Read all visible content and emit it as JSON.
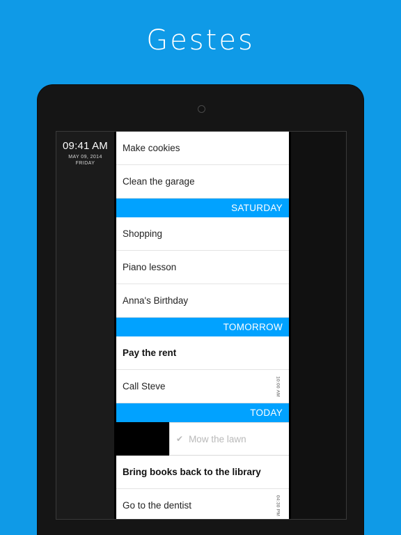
{
  "app": {
    "title": "Gestes",
    "background_color": "#0f9ae7",
    "accent_color": "#01a2ff"
  },
  "device": {
    "type": "tablet-frame",
    "camera": "camera-dot"
  },
  "clock": {
    "time": "09:41 AM",
    "date": "MAY 09, 2014",
    "weekday": "FRIDAY"
  },
  "list": {
    "rows": [
      {
        "kind": "task",
        "label": "Make cookies",
        "bold": false,
        "done": false,
        "time": ""
      },
      {
        "kind": "task",
        "label": "Clean the garage",
        "bold": false,
        "done": false,
        "time": ""
      },
      {
        "kind": "section",
        "label": "SATURDAY"
      },
      {
        "kind": "task",
        "label": "Shopping",
        "bold": false,
        "done": false,
        "time": ""
      },
      {
        "kind": "task",
        "label": "Piano lesson",
        "bold": false,
        "done": false,
        "time": ""
      },
      {
        "kind": "task",
        "label": "Anna's Birthday",
        "bold": false,
        "done": false,
        "time": ""
      },
      {
        "kind": "section",
        "label": "TOMORROW"
      },
      {
        "kind": "task",
        "label": "Pay the rent",
        "bold": true,
        "done": false,
        "time": ""
      },
      {
        "kind": "task",
        "label": "Call Steve",
        "bold": false,
        "done": false,
        "time": "10:00 AM"
      },
      {
        "kind": "section",
        "label": "TODAY"
      },
      {
        "kind": "swiped",
        "label": "Mow the lawn",
        "bold": false,
        "done": true,
        "time": "",
        "check_icon": "check-icon"
      },
      {
        "kind": "task",
        "label": "Bring books back to the library",
        "bold": true,
        "done": false,
        "time": ""
      },
      {
        "kind": "task",
        "label": "Go to the dentist",
        "bold": false,
        "done": false,
        "time": "04:30 PM"
      }
    ]
  }
}
